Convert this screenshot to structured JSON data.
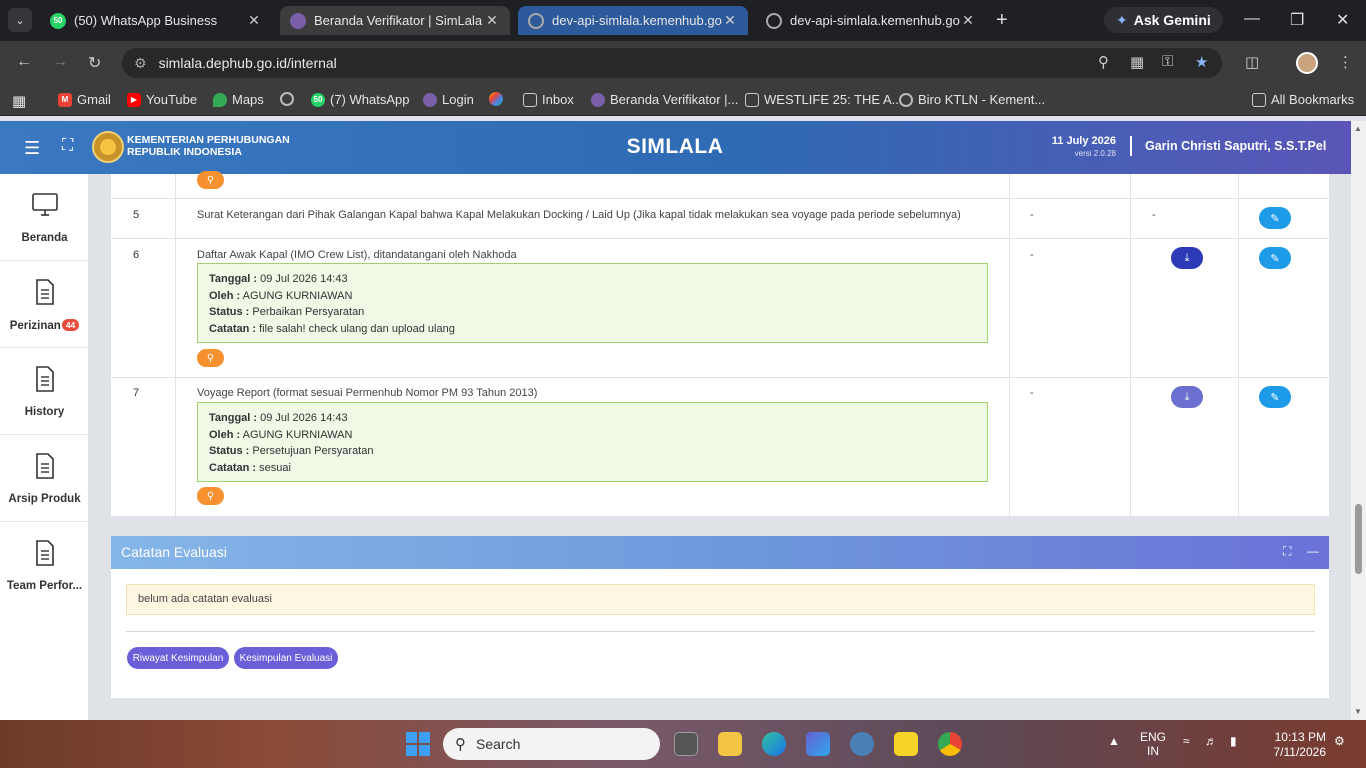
{
  "browser": {
    "tabs": [
      {
        "title": "(50) WhatsApp Business",
        "badge": "50"
      },
      {
        "title": "Beranda Verifikator | SimLala"
      },
      {
        "title": "dev-api-simlala.kemenhub.go.id"
      },
      {
        "title": "dev-api-simlala.kemenhub.go.id"
      }
    ],
    "gemini_label": "Ask Gemini",
    "url": "simlala.dephub.go.id/internal",
    "bookmarks": [
      {
        "label": "Gmail"
      },
      {
        "label": "YouTube"
      },
      {
        "label": "Maps"
      },
      {
        "label": "(7) WhatsApp",
        "badge": "50"
      },
      {
        "label": "Login"
      },
      {
        "label": "Inbox"
      },
      {
        "label": "Beranda Verifikator |..."
      },
      {
        "label": "WESTLIFE 25: THE A..."
      },
      {
        "label": "Biro KTLN - Kement..."
      }
    ],
    "all_bookmarks": "All Bookmarks"
  },
  "header": {
    "ministry_line1": "KEMENTERIAN PERHUBUNGAN",
    "ministry_line2": "REPUBLIK INDONESIA",
    "app_title": "SIMLALA",
    "date": "11 July 2026",
    "version": "versi 2.0.28",
    "user": "Garin Christi Saputri, S.S.T.Pel"
  },
  "sidebar": {
    "items": [
      {
        "label": "Beranda"
      },
      {
        "label": "Perizinan",
        "badge": "44"
      },
      {
        "label": "History"
      },
      {
        "label": "Arsip Produk"
      },
      {
        "label": "Team Perfor..."
      }
    ]
  },
  "table": {
    "rows": [
      {
        "no": "5",
        "title": "Surat Keterangan dari Pihak Galangan Kapal bahwa Kapal Melakukan Docking / Laid Up (Jika kapal tidak melakukan sea voyage pada periode sebelumnya)",
        "col1": "-",
        "col2": "-"
      },
      {
        "no": "6",
        "title": "Daftar Awak Kapal (IMO Crew List), ditandatangani oleh Nakhoda",
        "col1": "-",
        "note": {
          "tanggal_label": "Tanggal :",
          "tanggal": "09 Jul 2026 14:43",
          "oleh_label": "Oleh :",
          "oleh": "AGUNG KURNIAWAN",
          "status_label": "Status :",
          "status": "Perbaikan Persyaratan",
          "catatan_label": "Catatan :",
          "catatan": "file salah! check ulang dan upload ulang"
        }
      },
      {
        "no": "7",
        "title": "Voyage Report (format sesuai Permenhub Nomor PM 93 Tahun 2013)",
        "col1": "-",
        "note": {
          "tanggal_label": "Tanggal :",
          "tanggal": "09 Jul 2026 14:43",
          "oleh_label": "Oleh :",
          "oleh": "AGUNG KURNIAWAN",
          "status_label": "Status :",
          "status": "Persetujuan Persyaratan",
          "catatan_label": "Catatan :",
          "catatan": "sesuai"
        }
      }
    ]
  },
  "evaluasi": {
    "title": "Catatan Evaluasi",
    "empty_text": "belum ada catatan evaluasi",
    "btn_riwayat": "Riwayat Kesimpulan",
    "btn_kesimpulan": "Kesimpulan Evaluasi"
  },
  "taskbar": {
    "search_label": "Search",
    "lang_line1": "ENG",
    "lang_line2": "IN",
    "time": "10:13 PM",
    "date": "7/11/2026"
  },
  "colors": {
    "accent": "#3a78c2",
    "edit": "#1e9be8",
    "download": "#2d3ab8",
    "search": "#f7912f",
    "note_bg": "#f0f8e6",
    "pill": "#6a5fd8"
  }
}
